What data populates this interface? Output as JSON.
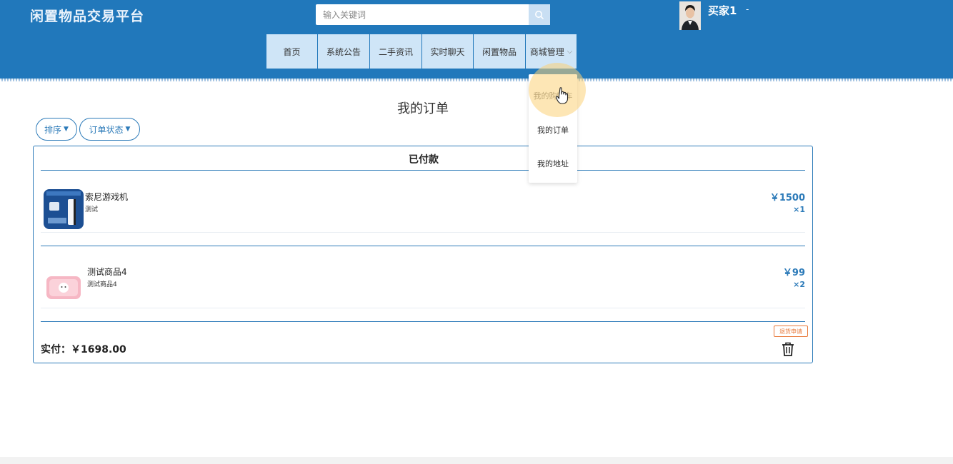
{
  "site": {
    "title": "闲置物品交易平台"
  },
  "search": {
    "placeholder": "输入关键词"
  },
  "user": {
    "name": "买家1",
    "caret": "-"
  },
  "nav": {
    "items": [
      "首页",
      "系统公告",
      "二手资讯",
      "实时聊天",
      "闲置物品",
      "商城管理"
    ],
    "dropdown": [
      "我的购物车",
      "我的订单",
      "我的地址"
    ]
  },
  "page": {
    "title": "我的订单",
    "filters": {
      "sort": "排序",
      "status": "订单状态"
    }
  },
  "order": {
    "status": "已付款",
    "items": [
      {
        "name": "索尼游戏机",
        "desc": "测试",
        "price": "￥1500",
        "qty": "×1"
      },
      {
        "name": "测试商品4",
        "desc": "测试商品4",
        "price": "￥99",
        "qty": "×2"
      }
    ],
    "total_label": "实付：￥1698.00",
    "refund_label": "退货申请"
  },
  "colors": {
    "header": "#2178bb",
    "accent": "#2d7bb9",
    "nav_bg": "#cfe5f7",
    "refund": "#e8793a"
  }
}
